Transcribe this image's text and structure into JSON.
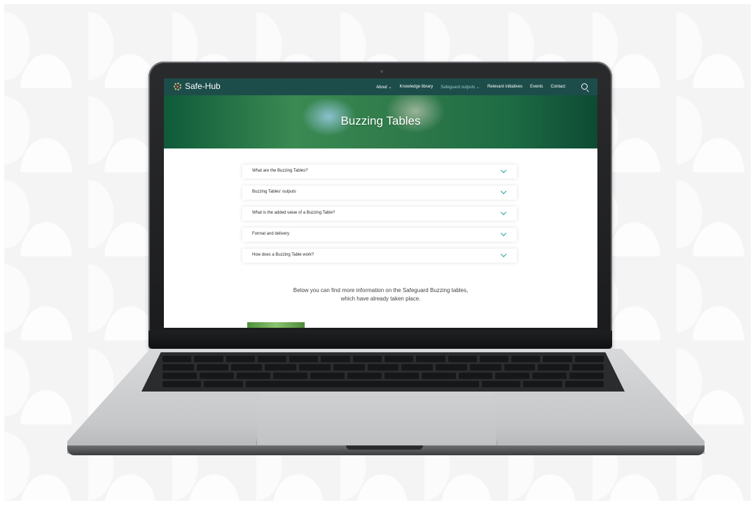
{
  "site": {
    "logo": "Safe-Hub",
    "nav": [
      {
        "label": "About ⌄",
        "active": false
      },
      {
        "label": "Knowledge library",
        "active": false
      },
      {
        "label": "Safeguard outputs ⌄",
        "active": true
      },
      {
        "label": "Relevant initiatives",
        "active": false
      },
      {
        "label": "Events",
        "active": false
      },
      {
        "label": "Contact",
        "active": false
      }
    ],
    "search_icon": "search-icon",
    "hero_title": "Buzzing Tables",
    "accordion": [
      {
        "label": "What are the Buzzing Tables?"
      },
      {
        "label": "Buzzing Tables' outputs"
      },
      {
        "label": "What is the added value of a Buzzing Table?"
      },
      {
        "label": "Format and delivery"
      },
      {
        "label": "How does a Buzzing Table work?"
      }
    ],
    "info_line1": "Below you can find more information on the Safeguard Buzzing tables,",
    "info_line2": "which have already taken place.",
    "colors": {
      "nav_bg": "#1d4d4a",
      "accent": "#2aa198"
    }
  }
}
